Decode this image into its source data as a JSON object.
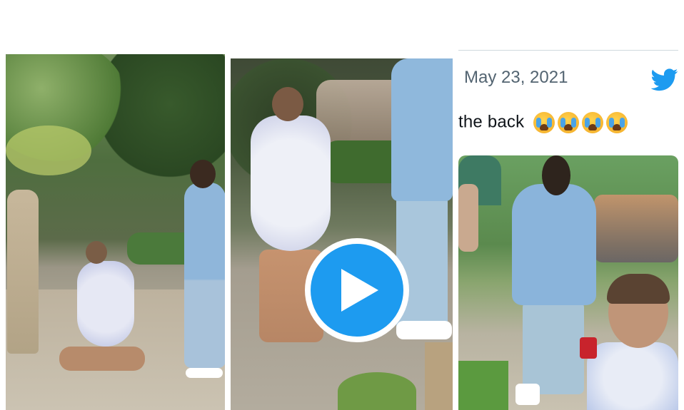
{
  "tweet": {
    "date": "May 23, 2021",
    "text": "the back",
    "emojis": [
      "loudly-crying-face",
      "loudly-crying-face",
      "loudly-crying-face",
      "loudly-crying-face"
    ],
    "brand_icon": "twitter-bird-icon",
    "brand_color": "#1d9bf0"
  },
  "video": {
    "play_icon": "play-icon",
    "play_color": "#1d9bf0"
  },
  "panels": [
    {
      "id": "panel-1",
      "kind": "photo"
    },
    {
      "id": "panel-2",
      "kind": "video-thumbnail"
    },
    {
      "id": "panel-3",
      "kind": "tweet-crop"
    }
  ]
}
